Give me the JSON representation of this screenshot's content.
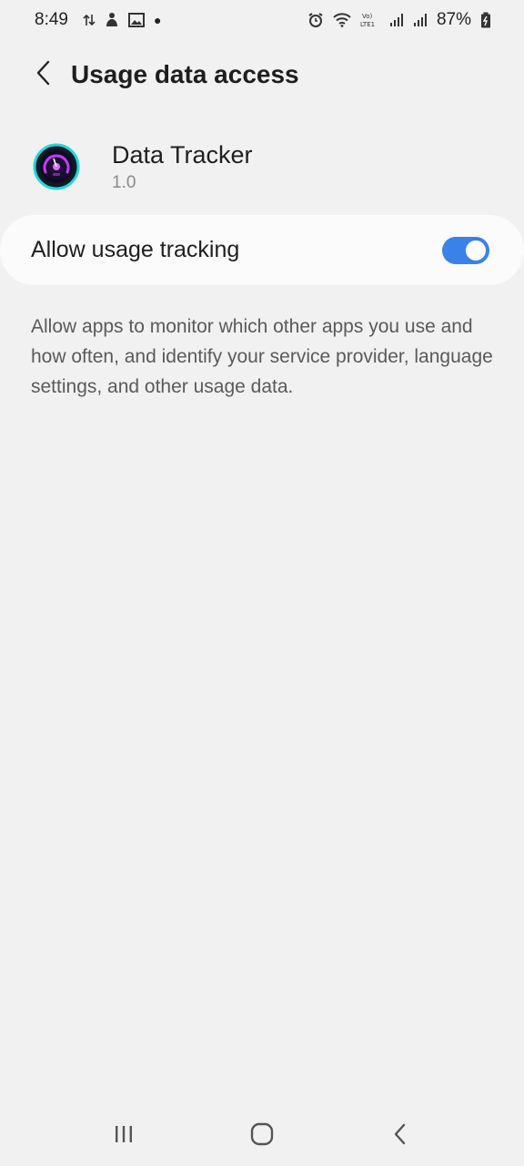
{
  "status_bar": {
    "time": "8:49",
    "battery": "87%",
    "left_icons": [
      "data-arrows-icon",
      "notification-icon",
      "gallery-icon",
      "dot-icon"
    ],
    "right_icons": [
      "alarm-icon",
      "wifi-icon",
      "volte-icon",
      "signal-icon",
      "signal-icon",
      "battery-icon"
    ],
    "volte_text": "Vo) LTE1"
  },
  "header": {
    "title": "Usage data access",
    "back_icon": "chevron-left-icon"
  },
  "app": {
    "name": "Data Tracker",
    "version": "1.0",
    "icon": "speedometer-app-icon"
  },
  "toggle": {
    "label": "Allow usage tracking",
    "checked": true,
    "accent_color": "#3b82e8"
  },
  "description": "Allow apps to monitor which other apps you use and how often, and identify your service provider, language settings, and other usage data.",
  "nav_bar": {
    "buttons": [
      "recent-apps-icon",
      "home-icon",
      "back-icon"
    ]
  }
}
